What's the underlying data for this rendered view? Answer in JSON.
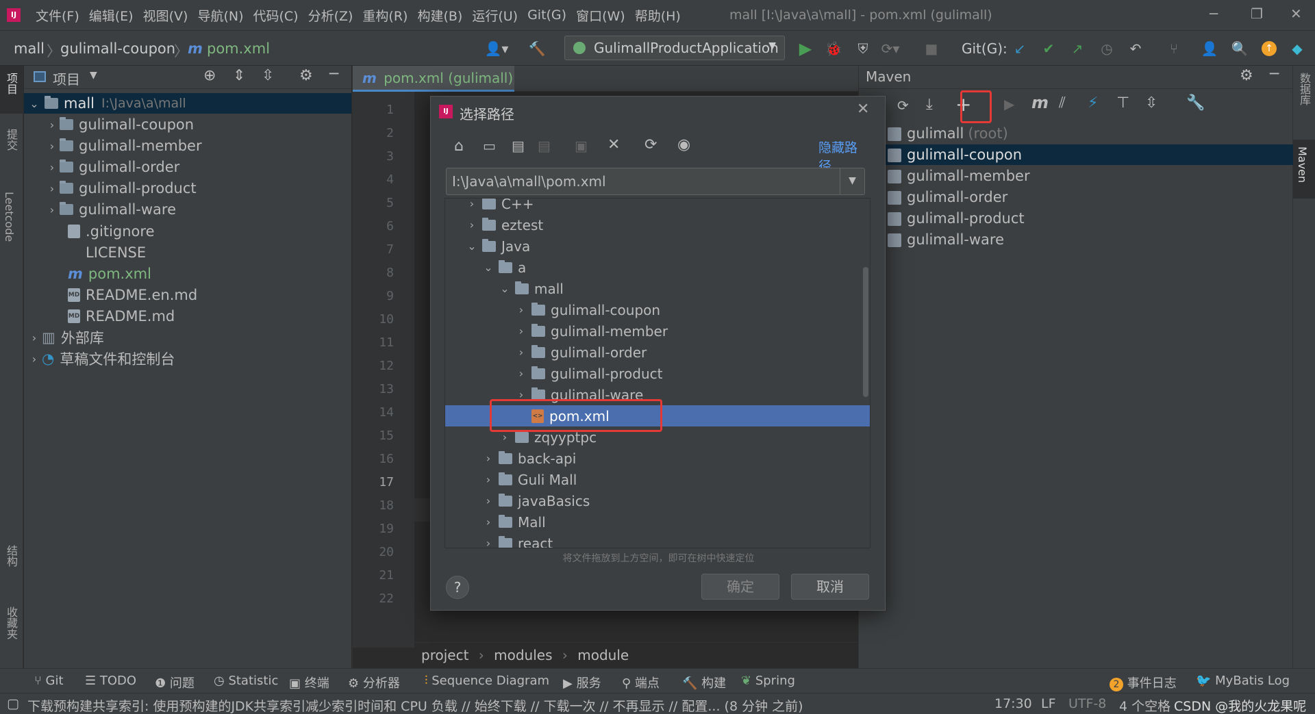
{
  "menu": {
    "items": [
      "文件(F)",
      "编辑(E)",
      "视图(V)",
      "导航(N)",
      "代码(C)",
      "分析(Z)",
      "重构(R)",
      "构建(B)",
      "运行(U)",
      "Git(G)",
      "窗口(W)",
      "帮助(H)"
    ],
    "window_title": "mall [I:\\Java\\a\\mall] - pom.xml (gulimall)"
  },
  "breadcrumb": {
    "root": "mall",
    "module": "gulimall-coupon",
    "file": "pom.xml"
  },
  "toolbar": {
    "run_config": "GulimallProductApplication",
    "git_label": "Git(G):"
  },
  "left_stripe": {
    "project": "项目",
    "commit": "提交",
    "leetcode": "Leetcode",
    "structure": "结构",
    "favorites": "收藏夹"
  },
  "right_stripe": {
    "database": "数据库",
    "maven": "Maven"
  },
  "project_panel": {
    "title": "项目",
    "root": {
      "name": "mall",
      "path": "I:\\Java\\a\\mall"
    },
    "modules": [
      "gulimall-coupon",
      "gulimall-member",
      "gulimall-order",
      "gulimall-product",
      "gulimall-ware"
    ],
    "files": [
      ".gitignore",
      "LICENSE",
      "pom.xml",
      "README.en.md",
      "README.md"
    ],
    "external_libs": "外部库",
    "scratches": "草稿文件和控制台"
  },
  "editor": {
    "tab": "pom.xml (gulimall)",
    "line_numbers": [
      "1",
      "2",
      "3",
      "4",
      "5",
      "6",
      "7",
      "8",
      "9",
      "10",
      "11",
      "12",
      "13",
      "14",
      "15",
      "16",
      "17",
      "18",
      "19",
      "20",
      "21",
      "22"
    ],
    "breadcrumb": [
      "project",
      "modules",
      "module"
    ]
  },
  "maven": {
    "title": "Maven",
    "items": [
      {
        "name": "gulimall",
        "suffix": "(root)"
      },
      {
        "name": "gulimall-coupon",
        "suffix": ""
      },
      {
        "name": "gulimall-member",
        "suffix": ""
      },
      {
        "name": "gulimall-order",
        "suffix": ""
      },
      {
        "name": "gulimall-product",
        "suffix": ""
      },
      {
        "name": "gulimall-ware",
        "suffix": ""
      }
    ],
    "selected": "gulimall-coupon"
  },
  "dialog": {
    "title": "选择路径",
    "hide_path": "隐藏路径",
    "path_value": "I:\\Java\\a\\mall\\pom.xml",
    "tree": [
      {
        "label": "C++",
        "depth": 0,
        "state": "collapsed"
      },
      {
        "label": "eztest",
        "depth": 0,
        "state": "collapsed"
      },
      {
        "label": "Java",
        "depth": 0,
        "state": "expanded"
      },
      {
        "label": "a",
        "depth": 1,
        "state": "expanded"
      },
      {
        "label": "mall",
        "depth": 2,
        "state": "expanded"
      },
      {
        "label": "gulimall-coupon",
        "depth": 3,
        "state": "collapsed"
      },
      {
        "label": "gulimall-member",
        "depth": 3,
        "state": "collapsed"
      },
      {
        "label": "gulimall-order",
        "depth": 3,
        "state": "collapsed"
      },
      {
        "label": "gulimall-product",
        "depth": 3,
        "state": "collapsed"
      },
      {
        "label": "gulimall-ware",
        "depth": 3,
        "state": "collapsed"
      },
      {
        "label": "pom.xml",
        "depth": 3,
        "state": "file"
      },
      {
        "label": "zqyyptpc",
        "depth": 2,
        "state": "collapsed"
      },
      {
        "label": "back-api",
        "depth": 1,
        "state": "collapsed"
      },
      {
        "label": "Guli Mall",
        "depth": 1,
        "state": "collapsed"
      },
      {
        "label": "javaBasics",
        "depth": 1,
        "state": "collapsed"
      },
      {
        "label": "Mall",
        "depth": 1,
        "state": "collapsed"
      },
      {
        "label": "react",
        "depth": 1,
        "state": "collapsed"
      }
    ],
    "hint": "将文件拖放到上方空间，即可在树中快速定位",
    "ok": "确定",
    "cancel": "取消",
    "help": "?"
  },
  "tool_windows": {
    "left": [
      "Git",
      "TODO",
      "问题",
      "Statistic",
      "终端",
      "分析器",
      "Sequence Diagram",
      "服务",
      "端点",
      "构建",
      "Spring"
    ],
    "event_log_count": "2",
    "event_log": "事件日志",
    "mybatis": "MyBatis Log"
  },
  "status": {
    "message": "下载预构建共享索引: 使用预构建的JDK共享索引减少索引时间和 CPU 负载 // 始终下载 // 下载一次 // 不再显示 // 配置... (8 分钟 之前)",
    "caret": "17:30",
    "line_sep": "LF",
    "encoding": "UTF-8",
    "indent": "4 个空格",
    "watermark": "CSDN @我的火龙果呢"
  },
  "colors": {
    "accent": "#4b6eaf",
    "highlight_red": "#e53935",
    "bg": "#3c3f41",
    "editor_bg": "#2b2b2b",
    "run_green": "#499c54",
    "git_blue": "#3592c4"
  }
}
